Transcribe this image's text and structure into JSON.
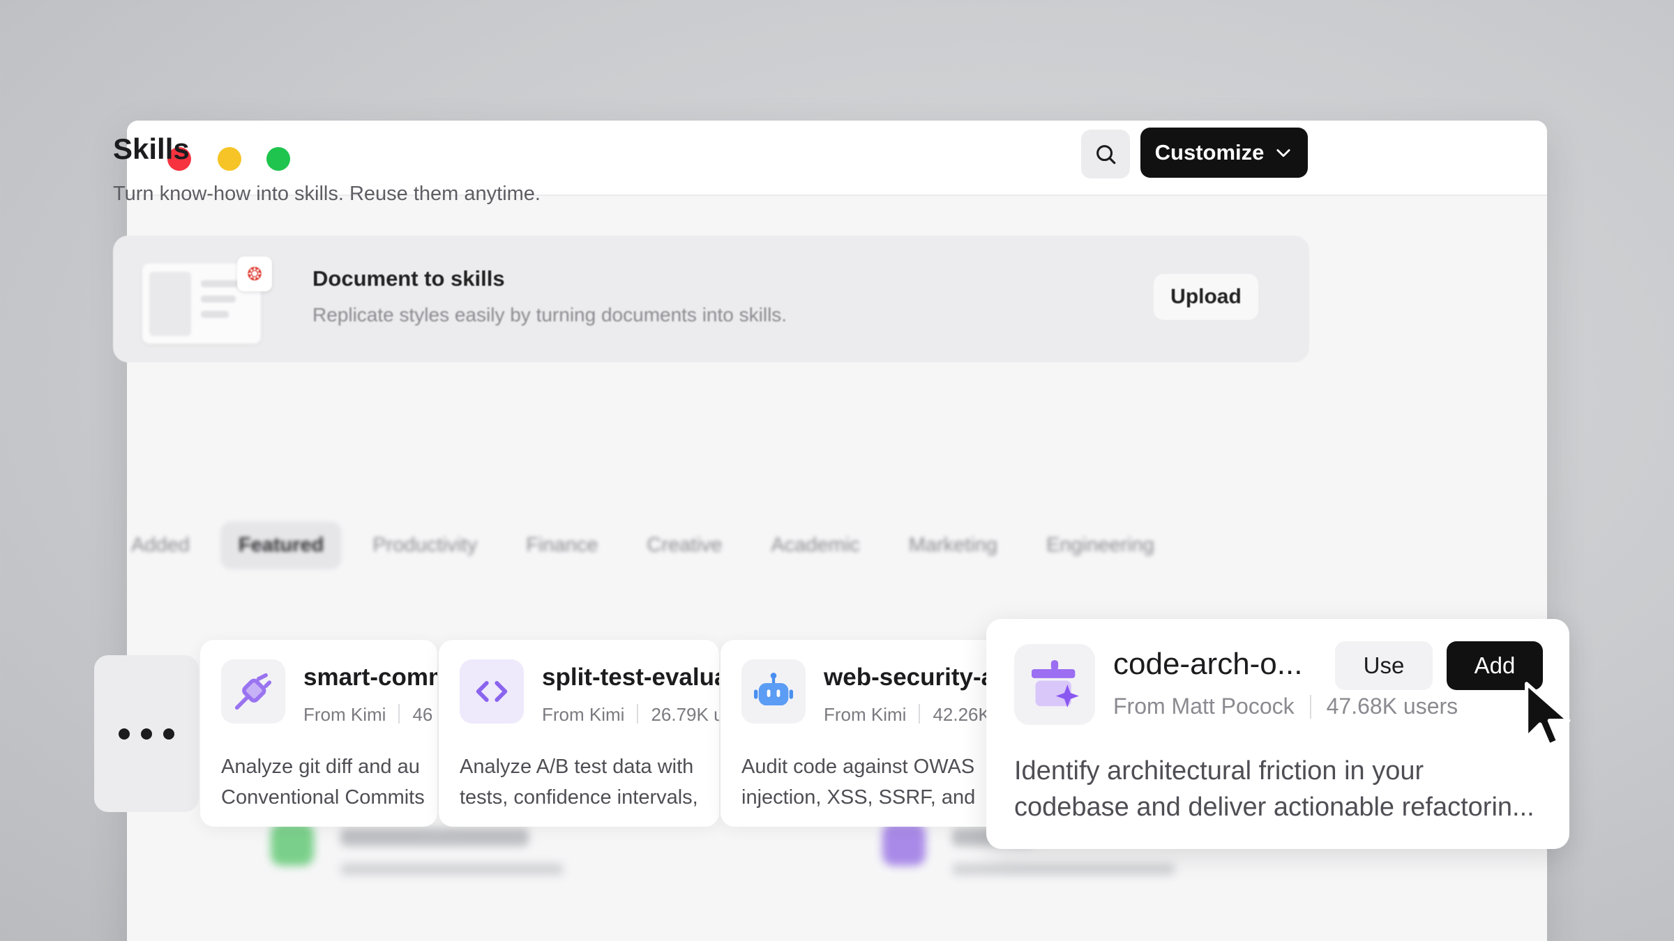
{
  "window": {
    "controls": [
      "close",
      "minimize",
      "maximize"
    ],
    "colors": {
      "close": "#f6333f",
      "minimize": "#f6c426",
      "maximize": "#1ec44d"
    }
  },
  "header": {
    "title": "Skills",
    "subtitle": "Turn know-how into skills. Reuse them anytime.",
    "search_icon": "search-icon",
    "customize_label": "Customize"
  },
  "banner": {
    "title": "Document to skills",
    "subtitle": "Replicate styles easily by turning documents into skills.",
    "upload_label": "Upload"
  },
  "tabs": [
    {
      "label": "Added",
      "active": false
    },
    {
      "label": "Featured",
      "active": true
    },
    {
      "label": "Productivity",
      "active": false
    },
    {
      "label": "Finance",
      "active": false
    },
    {
      "label": "Creative",
      "active": false
    },
    {
      "label": "Academic",
      "active": false
    },
    {
      "label": "Marketing",
      "active": false
    },
    {
      "label": "Engineering",
      "active": false
    }
  ],
  "cards": [
    {
      "name": "smart-comm",
      "source": "From Kimi",
      "users": "46",
      "desc_line1": "Analyze git diff and au",
      "desc_line2": "Conventional Commits",
      "icon": "plug-icon"
    },
    {
      "name": "split-test-evalua",
      "source": "From Kimi",
      "users": "26.79K u",
      "desc_line1": "Analyze A/B test data with",
      "desc_line2": "tests, confidence intervals,",
      "icon": "code-icon"
    },
    {
      "name": "web-security-a",
      "source": "From Kimi",
      "users": "42.26K",
      "desc_line1": "Audit code against OWAS",
      "desc_line2": "injection, XSS, SSRF, and",
      "icon": "robot-icon"
    }
  ],
  "featured_card": {
    "name": "code-arch-o...",
    "source": "From Matt Pocock",
    "users": "47.68K users",
    "desc_line1": "Identify architectural friction in your",
    "desc_line2": "codebase and deliver actionable refactorin...",
    "use_label": "Use",
    "add_label": "Add",
    "icon": "puzzle-sparkle-icon"
  },
  "more_icon": "more-dots-icon"
}
